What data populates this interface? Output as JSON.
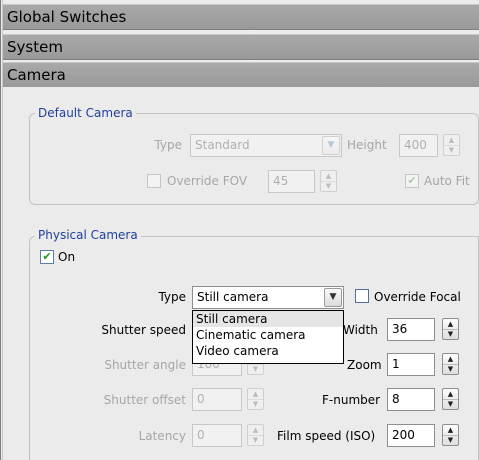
{
  "sections": {
    "global_switches": "Global Switches",
    "system": "System",
    "camera": "Camera"
  },
  "default_camera": {
    "legend": "Default Camera",
    "type_label": "Type",
    "type_value": "Standard",
    "height_label": "Height",
    "height_value": "400",
    "override_fov_label": "Override FOV",
    "override_fov_checked": false,
    "fov_value": "45",
    "auto_fit_label": "Auto Fit",
    "auto_fit_checked": true
  },
  "physical_camera": {
    "legend": "Physical Camera",
    "on_label": "On",
    "on_checked": true,
    "type_label": "Type",
    "type_value": "Still camera",
    "override_focal_label": "Override Focal",
    "override_focal_checked": false,
    "shutter_speed_label": "Shutter speed",
    "width_label": "Width",
    "width_value": "36",
    "shutter_angle_label": "Shutter angle",
    "shutter_angle_value": "180",
    "zoom_label": "Zoom",
    "zoom_value": "1",
    "shutter_offset_label": "Shutter offset",
    "shutter_offset_value": "0",
    "f_number_label": "F-number",
    "f_number_value": "8",
    "latency_label": "Latency",
    "latency_value": "0",
    "film_speed_label": "Film speed (ISO)",
    "film_speed_value": "200",
    "type_options": [
      "Still camera",
      "Cinematic camera",
      "Video camera"
    ],
    "type_selected_index": 0
  }
}
